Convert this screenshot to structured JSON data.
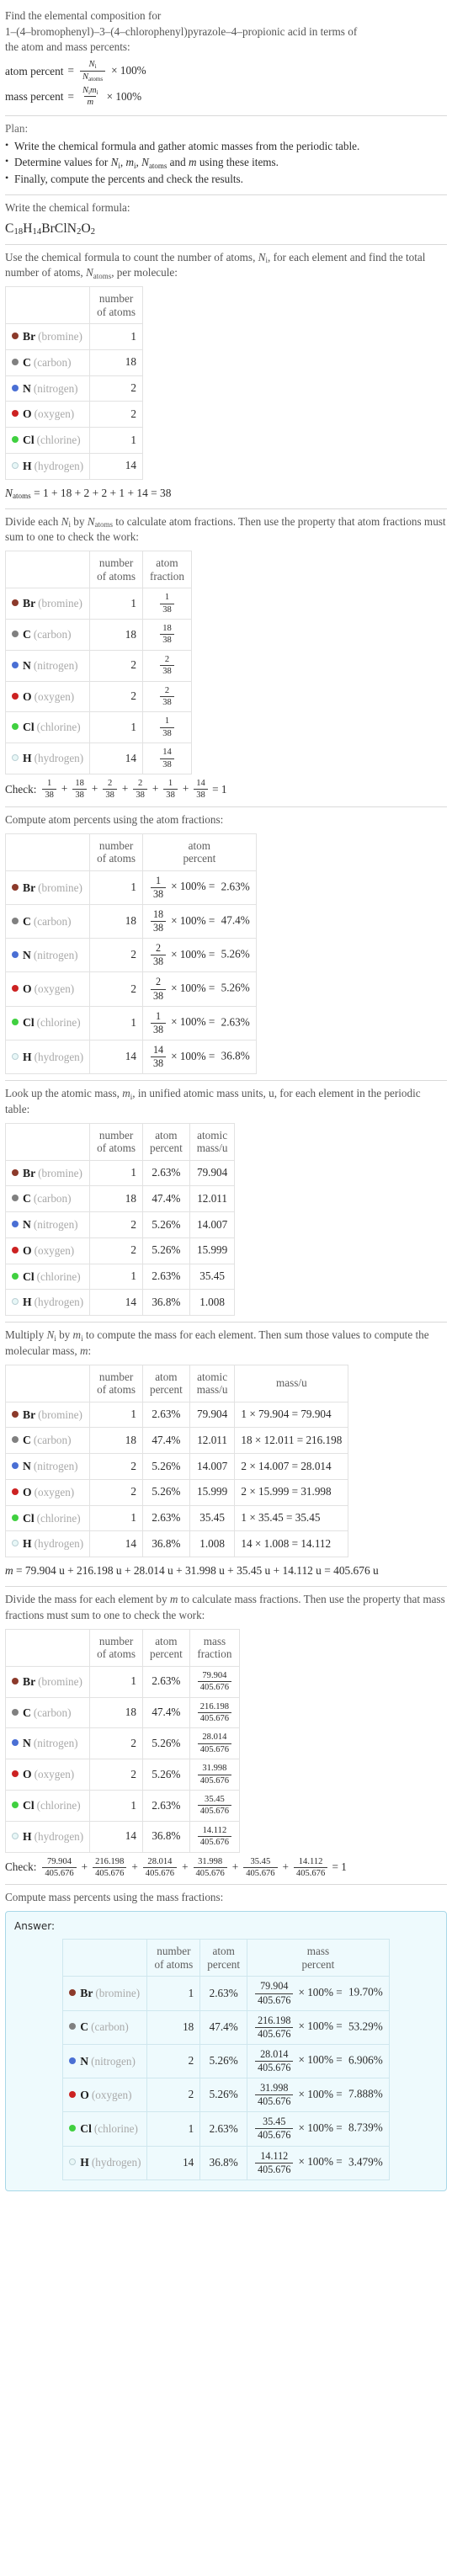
{
  "problem": {
    "line1": "Find the elemental composition for",
    "line2": "1–(4–bromophenyl)–3–(4–chlorophenyl)pyrazole–4–propionic acid in terms of",
    "line3": "the atom and mass percents:",
    "atom_percent_label": "atom percent",
    "mass_percent_label": "mass percent",
    "equals": "=",
    "times100": "× 100%",
    "atom_percent_num": "N",
    "atom_percent_num_sub": "i",
    "atom_percent_den": "N",
    "atom_percent_den_sub": "atoms",
    "mass_percent_num": "N",
    "mass_percent_num_sub": "i",
    "mass_percent_num2": "m",
    "mass_percent_num2_sub": "i",
    "mass_percent_den": "m"
  },
  "plan": {
    "title": "Plan:",
    "items": [
      "Write the chemical formula and gather atomic masses from the periodic table.",
      "Determine values for Nᵢ, mᵢ, Nₐₜₒₘₛ and m using these items.",
      "Finally, compute the percents and check the results."
    ],
    "item2_parts": [
      "Determine values for ",
      "N",
      "i",
      ", ",
      "m",
      "i",
      ", ",
      "N",
      "atoms",
      " and ",
      "m",
      " using these items."
    ]
  },
  "formula_section": {
    "heading": "Write the chemical formula:",
    "formula_parts": [
      {
        "sym": "C",
        "sub": "18"
      },
      {
        "sym": "H",
        "sub": "14"
      },
      {
        "sym": "Br",
        "sub": ""
      },
      {
        "sym": "Cl",
        "sub": ""
      },
      {
        "sym": "N",
        "sub": "2"
      },
      {
        "sym": "O",
        "sub": "2"
      }
    ],
    "formula_plain": "C18H14BrClN2O2"
  },
  "count_section": {
    "heading_a": "Use the chemical formula to count the number of atoms, ",
    "heading_a_mi": "N",
    "heading_a_sub": "i",
    "heading_b": ", for each element",
    "heading_c": "and find the total number of atoms, ",
    "heading_c_mi": "N",
    "heading_c_sub": "atoms",
    "heading_d": ", per molecule:",
    "col_blank": "",
    "col_atoms_l1": "number",
    "col_atoms_l2": "of atoms",
    "total_label": "N",
    "total_label_sub": "atoms",
    "total_expr": "= 1 + 18 + 2 + 2 + 1 + 14 = 38"
  },
  "fraction_section": {
    "heading_a": "Divide each ",
    "heading_a_mi": "N",
    "heading_a_sub": "i",
    "heading_b": " by ",
    "heading_b_mi": "N",
    "heading_b_sub": "atoms",
    "heading_c": " to calculate atom fractions. Then use the property that",
    "heading_d": "atom fractions must sum to one to check the work:",
    "col_frac_l1": "atom",
    "col_frac_l2": "fraction",
    "check_label": "Check:",
    "check_result": "= 1",
    "plus": "+"
  },
  "atom_percent_section": {
    "heading": "Compute atom percents using the atom fractions:",
    "col_pct_l1": "atom",
    "col_pct_l2": "percent"
  },
  "atomic_mass_section": {
    "heading_a": "Look up the atomic mass, ",
    "heading_a_mi": "m",
    "heading_a_sub": "i",
    "heading_b": ", in unified atomic mass units, u, for each element in",
    "heading_c": "the periodic table:",
    "col_pct_l1": "atom",
    "col_pct_l2": "percent",
    "col_mass_l1": "atomic",
    "col_mass_l2": "mass/u"
  },
  "multiply_section": {
    "heading_a": "Multiply ",
    "heading_a_mi": "N",
    "heading_a_sub": "i",
    "heading_b": " by ",
    "heading_b_mi": "m",
    "heading_b_sub": "i",
    "heading_c": " to compute the mass for each element. Then sum those values",
    "heading_d": "to compute the molecular mass, ",
    "heading_d_mi": "m",
    "heading_d_end": ":",
    "col_massu": "mass/u",
    "mol_mass_label": "m",
    "mol_mass_expr": "= 79.904 u + 216.198 u + 28.014 u + 31.998 u + 35.45 u + 14.112 u = 405.676 u"
  },
  "mass_fraction_section": {
    "heading_a": "Divide the mass for each element by ",
    "heading_a_mi": "m",
    "heading_b": " to calculate mass fractions. Then use the",
    "heading_c": "property that mass fractions must sum to one to check the work:",
    "col_mf_l1": "mass",
    "col_mf_l2": "fraction",
    "check_label": "Check:",
    "check_result": "= 1"
  },
  "mass_percent_section": {
    "heading": "Compute mass percents using the mass fractions:",
    "answer_label": "Answer:",
    "col_mp_l1": "mass",
    "col_mp_l2": "percent"
  },
  "colors": {
    "bromine": "#8c3a2b",
    "carbon": "#808080",
    "nitrogen": "#4a6fd4",
    "oxygen": "#cc2222",
    "chlorine": "#40d040",
    "hydrogen": "#e8f7f7",
    "hydrogen_border": "#b9cfd4",
    "answer_bg": "#eefafd",
    "answer_border": "#a9d8e8",
    "table_border": "#e2e2e2",
    "rule": "#d9d9d9"
  },
  "chart_data": {
    "type": "table",
    "title": "Elemental composition of C18H14BrClN2O2",
    "total_atoms": 38,
    "molecular_mass_u": 405.676,
    "elements": [
      {
        "symbol": "Br",
        "name": "(bromine)",
        "color": "#8c3a2b",
        "count": "1",
        "atom_fraction_num": "1",
        "atom_fraction_den": "38",
        "atom_percent": "2.63%",
        "atomic_mass": "79.904",
        "mass_expr": "1 × 79.904 = 79.904",
        "mass_value": "79.904",
        "mass_fraction_num": "79.904",
        "mass_fraction_den": "405.676",
        "mass_percent": "19.70%"
      },
      {
        "symbol": "C",
        "name": "(carbon)",
        "color": "#808080",
        "count": "18",
        "atom_fraction_num": "18",
        "atom_fraction_den": "38",
        "atom_percent": "47.4%",
        "atomic_mass": "12.011",
        "mass_expr": "18 × 12.011 = 216.198",
        "mass_value": "216.198",
        "mass_fraction_num": "216.198",
        "mass_fraction_den": "405.676",
        "mass_percent": "53.29%"
      },
      {
        "symbol": "N",
        "name": "(nitrogen)",
        "color": "#4a6fd4",
        "count": "2",
        "atom_fraction_num": "2",
        "atom_fraction_den": "38",
        "atom_percent": "5.26%",
        "atomic_mass": "14.007",
        "mass_expr": "2 × 14.007 = 28.014",
        "mass_value": "28.014",
        "mass_fraction_num": "28.014",
        "mass_fraction_den": "405.676",
        "mass_percent": "6.906%"
      },
      {
        "symbol": "O",
        "name": "(oxygen)",
        "color": "#cc2222",
        "count": "2",
        "atom_fraction_num": "2",
        "atom_fraction_den": "38",
        "atom_percent": "5.26%",
        "atomic_mass": "15.999",
        "mass_expr": "2 × 15.999 = 31.998",
        "mass_value": "31.998",
        "mass_fraction_num": "31.998",
        "mass_fraction_den": "405.676",
        "mass_percent": "7.888%"
      },
      {
        "symbol": "Cl",
        "name": "(chlorine)",
        "color": "#40d040",
        "count": "1",
        "atom_fraction_num": "1",
        "atom_fraction_den": "38",
        "atom_percent": "2.63%",
        "atomic_mass": "35.45",
        "mass_expr": "1 × 35.45 = 35.45",
        "mass_value": "35.45",
        "mass_fraction_num": "35.45",
        "mass_fraction_den": "405.676",
        "mass_percent": "8.739%"
      },
      {
        "symbol": "H",
        "name": "(hydrogen)",
        "color": "#e8f7f7",
        "count": "14",
        "atom_fraction_num": "14",
        "atom_fraction_den": "38",
        "atom_percent": "36.8%",
        "atomic_mass": "1.008",
        "mass_expr": "14 × 1.008 = 14.112",
        "mass_value": "14.112",
        "mass_fraction_num": "14.112",
        "mass_fraction_den": "405.676",
        "mass_percent": "3.479%"
      }
    ]
  }
}
